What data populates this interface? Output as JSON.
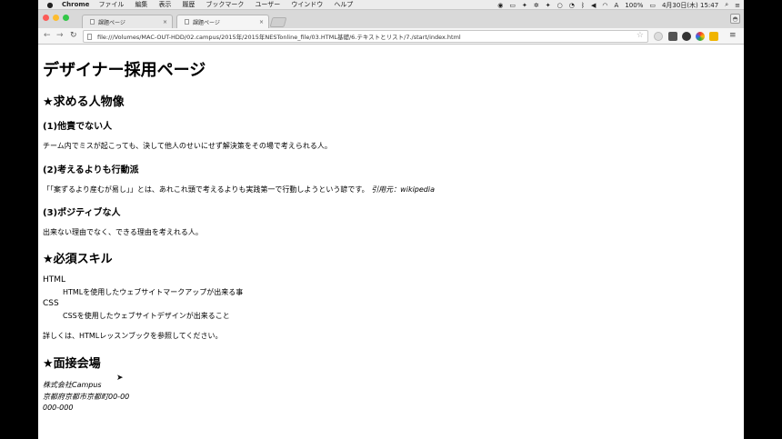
{
  "menubar": {
    "app": "Chrome",
    "items": [
      "ファイル",
      "編集",
      "表示",
      "履歴",
      "ブックマーク",
      "ユーザー",
      "ウインドウ",
      "ヘルプ"
    ],
    "battery": "100%",
    "datetime": "4月30日(木) 15:47"
  },
  "tabs": [
    {
      "label": "課題ページ",
      "close": "×"
    },
    {
      "label": "課題ページ",
      "close": "×"
    }
  ],
  "toolbar": {
    "url": "file:///Volumes/MAC-OUT-HDD/02.campus/2015年/2015年NESTonline_file/03.HTML基礎/6.テキストとリスト/7./start/index.html"
  },
  "page": {
    "title": "デザイナー採用ページ",
    "section1": {
      "heading": "★求める人物像",
      "items": [
        {
          "heading": "(1)他責でない人",
          "text": "チーム内でミスが起こっても、決して他人のせいにせず解決策をその場で考えられる人。"
        },
        {
          "heading": "(2)考えるよりも行動派",
          "text": "「「案ずるより産むが易し」」とは、あれこれ頭で考えるよりも実践第一で行動しようという諺です。",
          "cite": "引用元：wikipedia"
        },
        {
          "heading": "(3)ポジティブな人",
          "text": "出来ない理由でなく、できる理由を考えれる人。"
        }
      ]
    },
    "section2": {
      "heading": "★必須スキル",
      "skills": [
        {
          "term": "HTML",
          "desc": "HTMLを使用したウェブサイトマークアップが出来る事"
        },
        {
          "term": "CSS",
          "desc": "CSSを使用したウェブサイトデザインが出来ること"
        }
      ],
      "note": "詳しくは、HTMLレッスンブックを参照してください。"
    },
    "section3": {
      "heading": "★面接会場",
      "address": [
        "株式会社Campus",
        "京都府京都市京都町00-00",
        "000-000"
      ]
    }
  }
}
